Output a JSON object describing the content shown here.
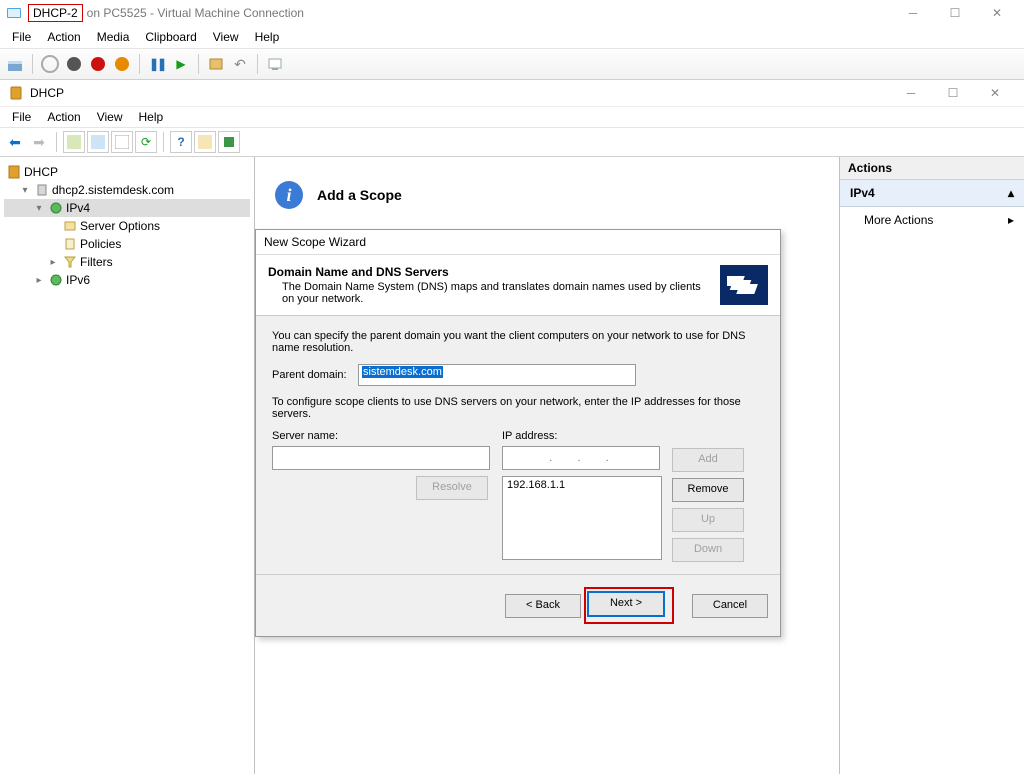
{
  "vm": {
    "name_highlight": "DHCP-2",
    "title_rest": "on PC5525 - Virtual Machine Connection",
    "menu": [
      "File",
      "Action",
      "Media",
      "Clipboard",
      "View",
      "Help"
    ]
  },
  "mmc": {
    "title": "DHCP",
    "menu": [
      "File",
      "Action",
      "View",
      "Help"
    ]
  },
  "tree": {
    "root": "DHCP",
    "server": "dhcp2.sistemdesk.com",
    "ipv4": "IPv4",
    "ipv4_children": [
      "Server Options",
      "Policies",
      "Filters"
    ],
    "ipv6": "IPv6"
  },
  "center": {
    "header": "Add a Scope"
  },
  "wizard": {
    "window_title": "New Scope Wizard",
    "heading": "Domain Name and DNS Servers",
    "subheading": "The Domain Name System (DNS) maps and translates domain names used by clients on your network.",
    "intro": "You can specify the parent domain you want the client computers on your network to use for DNS name resolution.",
    "parent_label": "Parent domain:",
    "parent_value": "sistemdesk.com",
    "dns_intro": "To configure scope clients to use DNS servers on your network, enter the IP addresses for those servers.",
    "server_name_label": "Server name:",
    "server_name_value": "",
    "ip_label": "IP address:",
    "ip_placeholder": ".   .   .",
    "ip_list": [
      "192.168.1.1"
    ],
    "buttons": {
      "add": "Add",
      "remove": "Remove",
      "up": "Up",
      "down": "Down",
      "resolve": "Resolve",
      "back": "< Back",
      "next": "Next >",
      "cancel": "Cancel"
    }
  },
  "actions": {
    "title": "Actions",
    "group": "IPv4",
    "more": "More Actions"
  }
}
